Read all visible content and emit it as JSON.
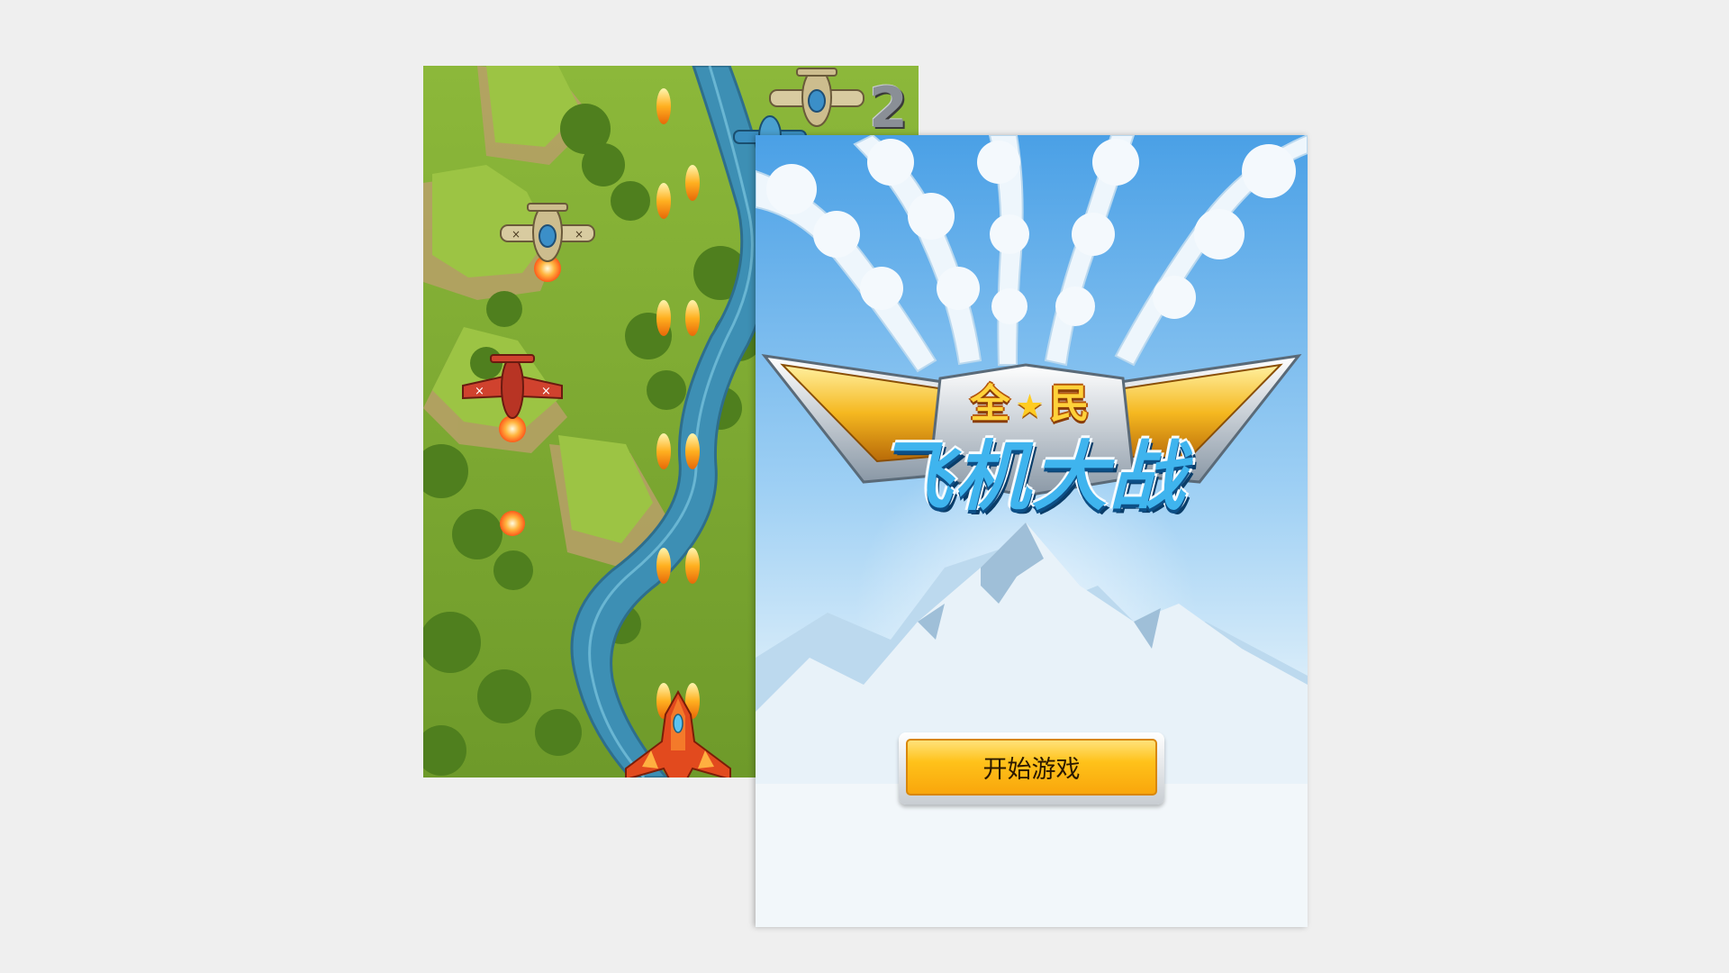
{
  "gameplay_screen": {
    "score": "2",
    "icons": [
      "terrain-background",
      "river",
      "player-jet-icon",
      "enemy-plane-icon",
      "enemy-red-plane-icon",
      "bullet-icon",
      "fireball-icon"
    ]
  },
  "title_screen": {
    "logo": {
      "top_text_left": "全",
      "top_text_right": "民",
      "main_text": "飞机大战"
    },
    "start_button_label": "开始游戏",
    "colors": {
      "button": "#ffc21a",
      "sky": "#4aa0e6",
      "logo_blue": "#3fb4ee",
      "logo_gold": "#ffd23a"
    }
  }
}
